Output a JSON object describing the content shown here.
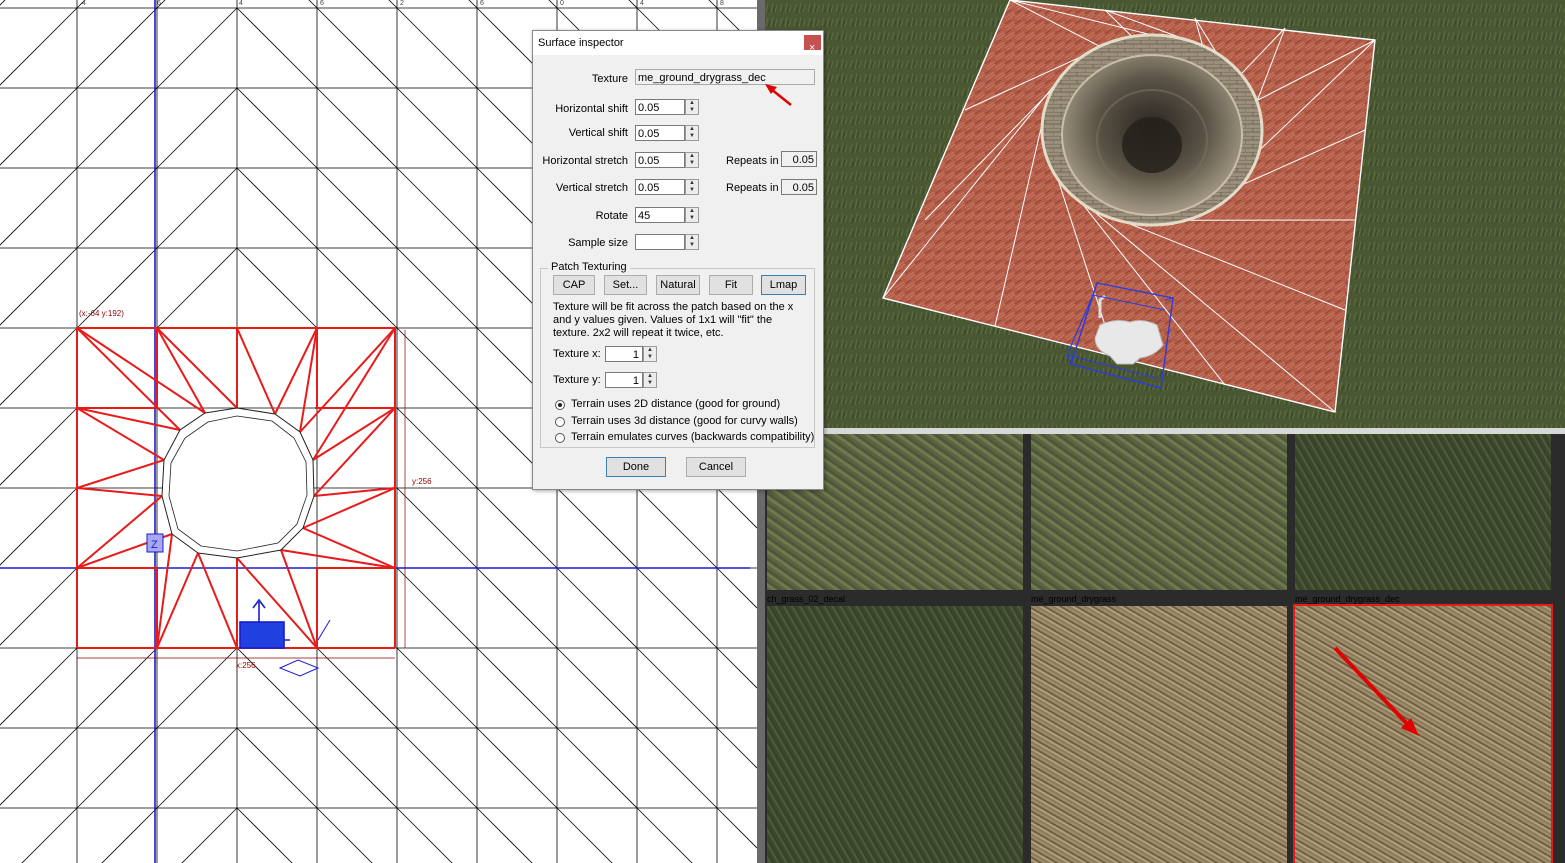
{
  "grid_view": {
    "corner_label": "(x:-64  y:192)",
    "y_label": "y:256",
    "x_label": "x:256",
    "ruler_ticks": [
      "4",
      "6",
      "4",
      "6",
      "2",
      "6",
      "0",
      "4",
      "8"
    ]
  },
  "surface_inspector": {
    "title": "Surface inspector",
    "close_glyph": "×",
    "texture_label": "Texture",
    "texture_value": "me_ground_drygrass_dec",
    "hshift_label": "Horizontal shift",
    "hshift_value": "0.05",
    "vshift_label": "Vertical shift",
    "vshift_value": "0.05",
    "hstretch_label": "Horizontal stretch",
    "hstretch_value": "0.05",
    "hrepeat_label": "Repeats in",
    "hrepeat_value": "0.05",
    "vstretch_label": "Vertical stretch",
    "vstretch_value": "0.05",
    "vrepeat_label": "Repeats in",
    "vrepeat_value": "0.05",
    "rotate_label": "Rotate",
    "rotate_value": "45",
    "sample_label": "Sample size",
    "sample_value": "",
    "patch_group_title": "Patch Texturing",
    "patch_buttons": [
      "CAP",
      "Set...",
      "Natural",
      "Fit",
      "Lmap"
    ],
    "patch_description": "Texture will be fit across the patch based on the x and y values given. Values of 1x1 will \"fit\" the texture. 2x2 will repeat it twice, etc.",
    "texture_x_label": "Texture x:",
    "texture_x_value": "1",
    "texture_y_label": "Texture y:",
    "texture_y_value": "1",
    "radio_options": [
      "Terrain uses 2D distance (good for ground)",
      "Terrain uses 3d distance (good for curvy walls)",
      "Terrain emulates curves (backwards compatibility)"
    ],
    "radio_selected": 0,
    "done_label": "Done",
    "cancel_label": "Cancel"
  },
  "texture_browser": {
    "tiles": [
      {
        "name": ""
      },
      {
        "name": ""
      },
      {
        "name": ""
      },
      {
        "name": "ch_grass_02_decal"
      },
      {
        "name": "me_ground_drygrass"
      },
      {
        "name": "me_ground_drygrass_dec"
      }
    ],
    "selected_index": 5
  },
  "colors": {
    "selection_red": "#e81b1b",
    "axis_blue": "#1b1bd0",
    "annotation_arrow": "#e00000"
  }
}
